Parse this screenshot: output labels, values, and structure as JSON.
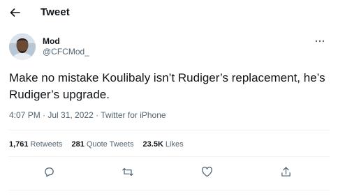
{
  "header": {
    "title": "Tweet",
    "back_icon": "arrow-left-icon"
  },
  "author": {
    "name": "Mod",
    "handle": "@CFCMod_",
    "more_icon": "more-options-icon"
  },
  "tweet": {
    "text": "Make no mistake Koulibaly isn’t Rudiger’s replacement, he’s Rudiger’s upgrade.",
    "meta": "4:07 PM · Jul 31, 2022 · Twitter for iPhone"
  },
  "stats": {
    "retweets": {
      "count": "1,761",
      "label": "Retweets"
    },
    "quote_tweets": {
      "count": "281",
      "label": "Quote Tweets"
    },
    "likes": {
      "count": "23.5K",
      "label": "Likes"
    }
  },
  "actions": {
    "reply_icon": "reply-icon",
    "retweet_icon": "retweet-icon",
    "like_icon": "heart-icon",
    "share_icon": "share-icon"
  },
  "colors": {
    "text": "#0f1419",
    "secondary": "#536471",
    "divider": "#eff3f4"
  }
}
